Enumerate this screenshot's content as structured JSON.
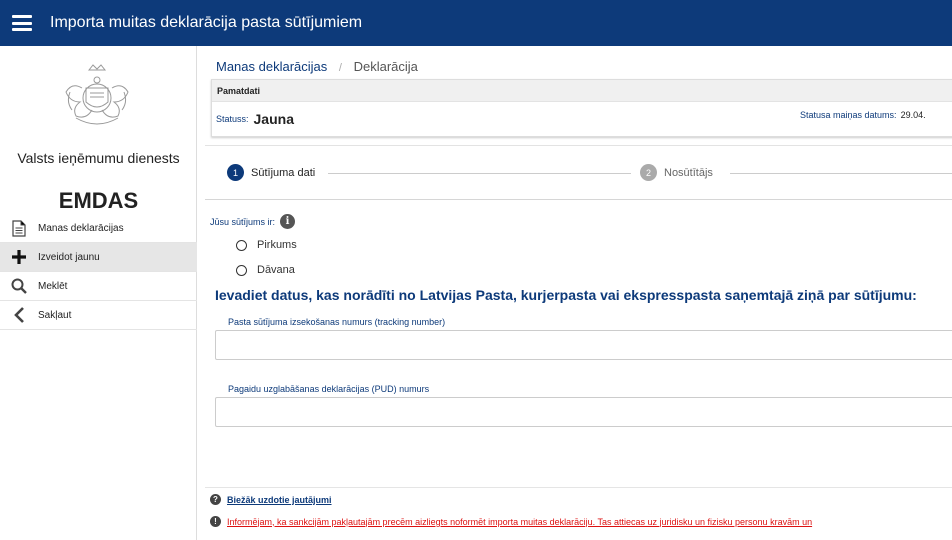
{
  "header": {
    "title": "Importa muitas deklarācija pasta sūtījumiem"
  },
  "sidebar": {
    "agency": "Valsts ieņēmumu dienests",
    "system": "EMDAS",
    "items": [
      {
        "label": "Manas deklarācijas",
        "icon": "document-icon"
      },
      {
        "label": "Izveidot jaunu",
        "icon": "plus-icon",
        "active": true
      },
      {
        "label": "Meklēt",
        "icon": "search-icon"
      },
      {
        "label": "Sakļaut",
        "icon": "chevron-left-icon"
      }
    ]
  },
  "breadcrumb": {
    "root": "Manas deklarācijas",
    "separator": "/",
    "current": "Deklarācija"
  },
  "card": {
    "header": "Pamatdati",
    "status_label": "Statuss:",
    "status_value": "Jauna",
    "date_label": "Statusa maiņas datums:",
    "date_value": "29.04."
  },
  "stepper": [
    {
      "num": "1",
      "label": "Sūtījuma dati",
      "active": true
    },
    {
      "num": "2",
      "label": "Nosūtītājs",
      "active": false
    }
  ],
  "form": {
    "question": "Jūsu sūtījums ir:",
    "options": [
      "Pirkums",
      "Dāvana"
    ],
    "heading": "Ievadiet datus, kas norādīti no Latvijas Pasta, kurjerpasta vai ekspresspasta saņemtajā ziņā par sūtījumu:",
    "tracking_label": "Pasta sūtījuma izsekošanas numurs (tracking number)",
    "tracking_value": "",
    "pud_label": "Pagaidu uzglabāšanas deklarācijas (PUD) numurs",
    "pud_value": ""
  },
  "footer": {
    "faq": "Biežāk uzdotie jautājumi",
    "notice": "Informējam, ka sankcijām pakļautajām precēm aizliegts noformēt importa muitas deklarāciju. Tas attiecas uz juridisku un fizisku personu kravām un"
  },
  "colors": {
    "primary": "#0d3a7a",
    "warning": "#dd1111",
    "active_bg": "#e6e6e6"
  }
}
